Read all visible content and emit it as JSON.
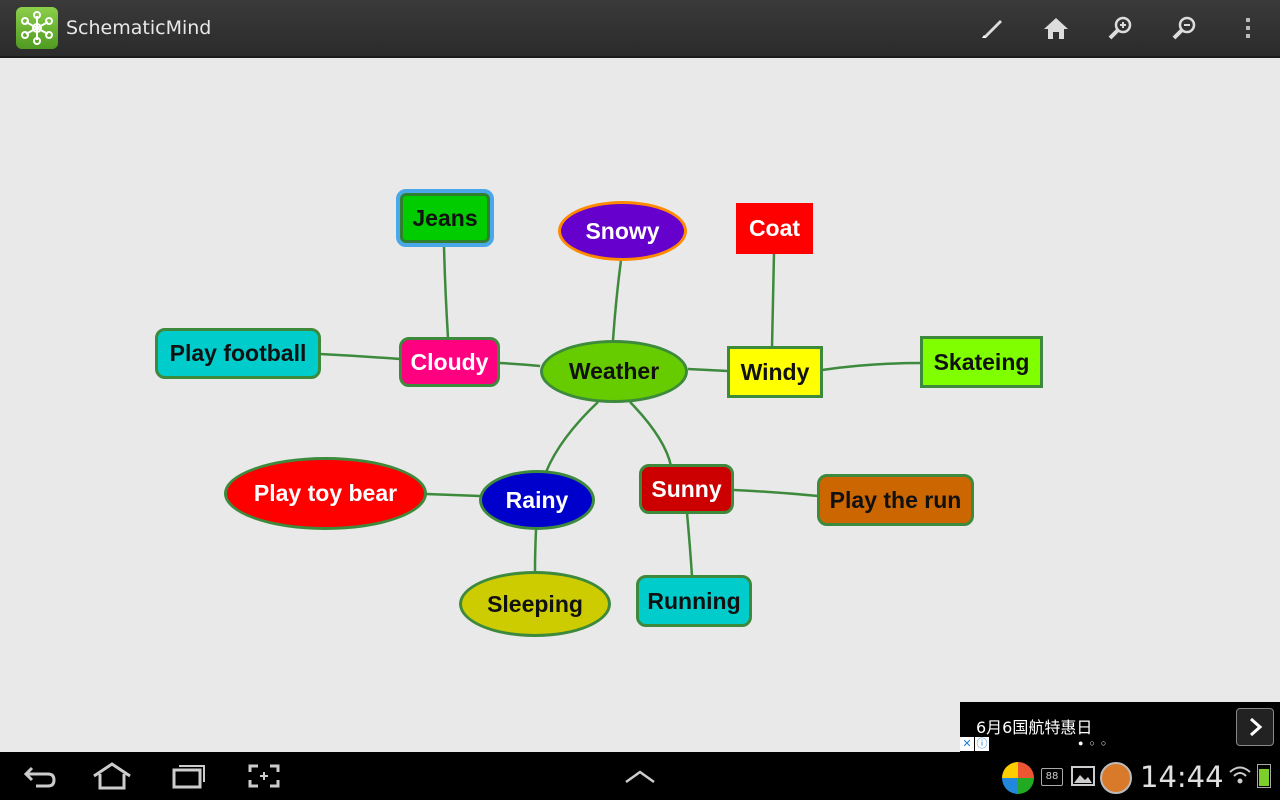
{
  "app": {
    "title": "SchematicMind"
  },
  "toolbar": {
    "icons": [
      "brush-icon",
      "home-icon",
      "zoom-in-icon",
      "zoom-out-icon",
      "overflow-menu-icon"
    ]
  },
  "mindmap": {
    "nodes": {
      "weather": "Weather",
      "snowy": "Snowy",
      "jeans": "Jeans",
      "coat": "Coat",
      "cloudy": "Cloudy",
      "play_football": "Play football",
      "windy": "Windy",
      "skateing": "Skateing",
      "rainy": "Rainy",
      "play_toy_bear": "Play toy bear",
      "sleeping": "Sleeping",
      "sunny": "Sunny",
      "play_the_run": "Play the run",
      "running": "Running"
    },
    "colors": {
      "link": "#3d8a3d",
      "weather": "#66cc00",
      "snowy": "#6600cc",
      "jeans": "#00cc00",
      "coat": "#ff0000",
      "cloudy": "#ff0080",
      "play_football": "#00cccc",
      "windy": "#ffff00",
      "skateing": "#80ff00",
      "rainy": "#0000cc",
      "play_toy_bear": "#ff0000",
      "sleeping": "#cccc00",
      "sunny": "#cc0000",
      "play_the_run": "#cc6600",
      "running": "#00cccc"
    }
  },
  "ad": {
    "text": "6月6国航特惠日"
  },
  "statusbar": {
    "time": "14:44",
    "notification_badge": "88"
  }
}
